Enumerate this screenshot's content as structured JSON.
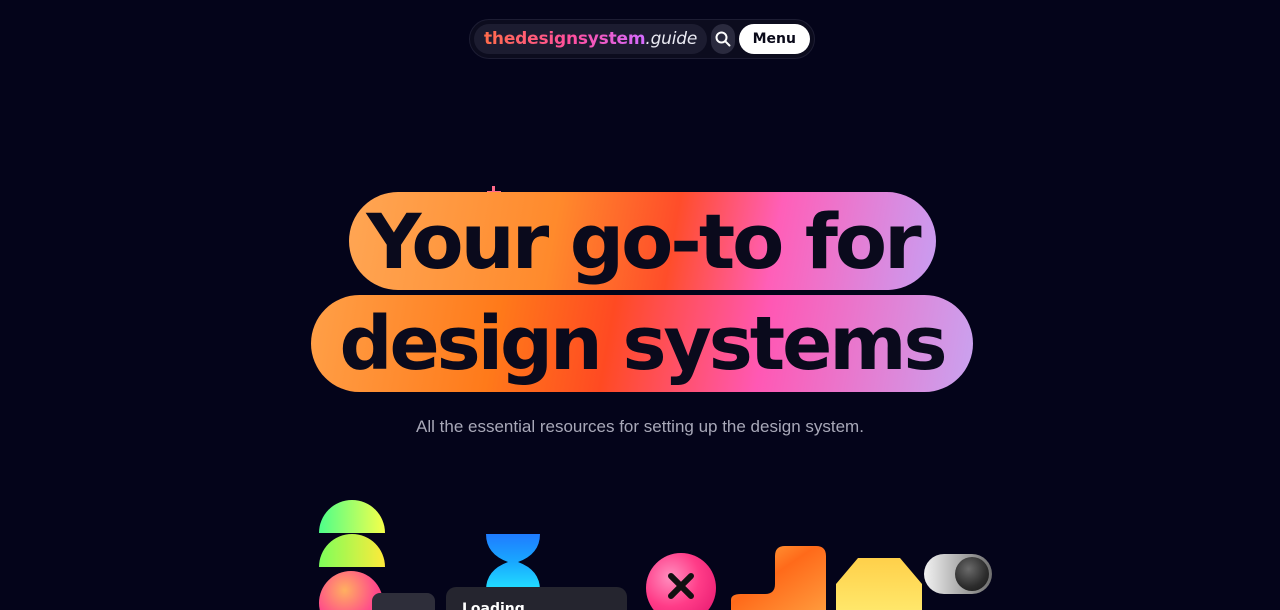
{
  "nav": {
    "brand_part1": "thedesignsystem",
    "brand_part2": ".guide",
    "search_icon": "search-icon",
    "menu_label": "Menu"
  },
  "hero": {
    "line1": "Your go-to for",
    "line2": "design systems",
    "subtitle": "All the essential resources for setting up the design system."
  },
  "decor": {
    "loading_card_text": "Loading",
    "close_icon": "close-icon"
  },
  "colors": {
    "background": "#04041a",
    "accent_orange": "#ff7a1a",
    "accent_pink": "#ff58b4",
    "accent_lavender": "#c9a3f0"
  }
}
